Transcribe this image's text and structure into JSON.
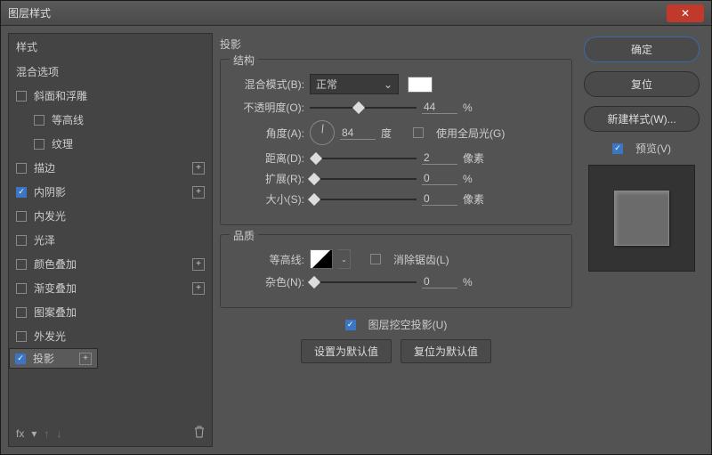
{
  "window": {
    "title": "图层样式"
  },
  "sidebar": {
    "header": "样式",
    "blend": "混合选项",
    "items": [
      {
        "label": "斜面和浮雕",
        "checked": false,
        "plus": false,
        "indent": false
      },
      {
        "label": "等高线",
        "checked": false,
        "plus": false,
        "indent": true
      },
      {
        "label": "纹理",
        "checked": false,
        "plus": false,
        "indent": true
      },
      {
        "label": "描边",
        "checked": false,
        "plus": true,
        "indent": false
      },
      {
        "label": "内阴影",
        "checked": true,
        "plus": true,
        "indent": false
      },
      {
        "label": "内发光",
        "checked": false,
        "plus": false,
        "indent": false
      },
      {
        "label": "光泽",
        "checked": false,
        "plus": false,
        "indent": false
      },
      {
        "label": "颜色叠加",
        "checked": false,
        "plus": true,
        "indent": false
      },
      {
        "label": "渐变叠加",
        "checked": false,
        "plus": true,
        "indent": false
      },
      {
        "label": "图案叠加",
        "checked": false,
        "plus": false,
        "indent": false
      },
      {
        "label": "外发光",
        "checked": false,
        "plus": false,
        "indent": false
      },
      {
        "label": "投影",
        "checked": true,
        "plus": true,
        "indent": false,
        "selected": true
      }
    ],
    "footer_fx": "fx"
  },
  "main": {
    "title": "投影",
    "struct": {
      "title": "结构",
      "blend_label": "混合模式(B):",
      "blend_value": "正常",
      "opacity_label": "不透明度(O):",
      "opacity_value": "44",
      "opacity_unit": "%",
      "angle_label": "角度(A):",
      "angle_value": "84",
      "angle_unit": "度",
      "global_light": "使用全局光(G)",
      "distance_label": "距离(D):",
      "distance_value": "2",
      "distance_unit": "像素",
      "spread_label": "扩展(R):",
      "spread_value": "0",
      "spread_unit": "%",
      "size_label": "大小(S):",
      "size_value": "0",
      "size_unit": "像素"
    },
    "quality": {
      "title": "品质",
      "contour_label": "等高线:",
      "antialias": "消除锯齿(L)",
      "noise_label": "杂色(N):",
      "noise_value": "0",
      "noise_unit": "%"
    },
    "knockout": "图层挖空投影(U)",
    "make_default": "设置为默认值",
    "reset_default": "复位为默认值"
  },
  "right": {
    "ok": "确定",
    "cancel": "复位",
    "new_style": "新建样式(W)...",
    "preview": "预览(V)"
  }
}
